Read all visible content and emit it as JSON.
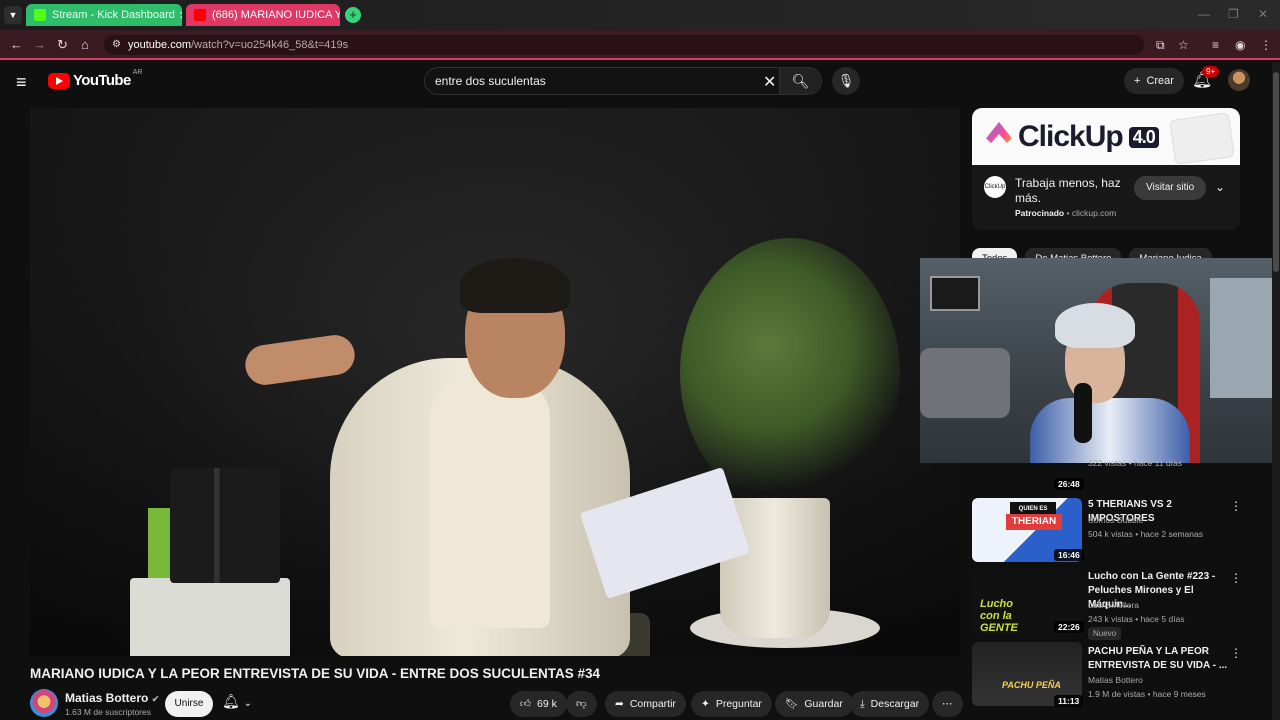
{
  "browser": {
    "tabs": [
      {
        "label": "Stream - Kick Dashboard",
        "active": false
      },
      {
        "label": "(686) MARIANO IUDICA Y LA PEOR",
        "active": true
      }
    ],
    "url_host": "youtube.com",
    "url_path": "/watch?v=uo254k46_58&t=419s"
  },
  "header": {
    "logo_text": "YouTube",
    "country_code": "AR",
    "search_query": "entre dos suculentas",
    "create_label": "Crear",
    "notifications_badge": "9+"
  },
  "video": {
    "title": "MARIANO IUDICA Y LA PEOR ENTREVISTA DE SU VIDA - ENTRE DOS SUCULENTAS #34",
    "channel_name": "Matias Bottero",
    "subscribers": "1.63 M de suscriptores",
    "join_label": "Unirse",
    "likes": "69 k",
    "share_label": "Compartir",
    "ask_label": "Preguntar",
    "save_label": "Guardar",
    "download_label": "Descargar"
  },
  "ad": {
    "brand": "ClickUp",
    "version": "4.0",
    "icon_text": "ClickUp",
    "text": "Trabaja menos, haz más.",
    "sponsored": "Patrocinado",
    "domain": "clickup.com",
    "visit_label": "Visitar sitio"
  },
  "chips": [
    "Todos",
    "De Matias Bottero",
    "Mariano Iudica"
  ],
  "partial_rec": {
    "meta": "322 vistas • hace 11 días",
    "duration": "26:48"
  },
  "recommendations": [
    {
      "title": "5 THERIANS VS 2 IMPOSTORES",
      "channel": "Somos Bubble",
      "meta": "504 k vistas • hace 2 semanas",
      "duration": "16:46",
      "thumb_top": "QUIEN ES",
      "thumb_mid": "THERIAN"
    },
    {
      "title": "Lucho con La Gente #223 - Peluches Mirones y El Máquin...",
      "channel": "LuchoMellera",
      "meta": "243 k vistas • hace 5 días",
      "duration": "22:26",
      "badge": "Nuevo",
      "thumb_logo": "Lucho con la GENTE"
    },
    {
      "title": "PACHU PEÑA Y LA PEOR ENTREVISTA DE SU VIDA - ...",
      "channel": "Matias Bottero",
      "meta": "1.9 M de vistas • hace 9 meses",
      "duration": "11:13",
      "thumb_name": "PACHU PEÑA"
    }
  ],
  "colors": {
    "kick_tab": "#2ebd6b",
    "youtube_tab": "#e03864",
    "youtube_red": "#ff0000",
    "page_bg": "#0f0f0f"
  }
}
